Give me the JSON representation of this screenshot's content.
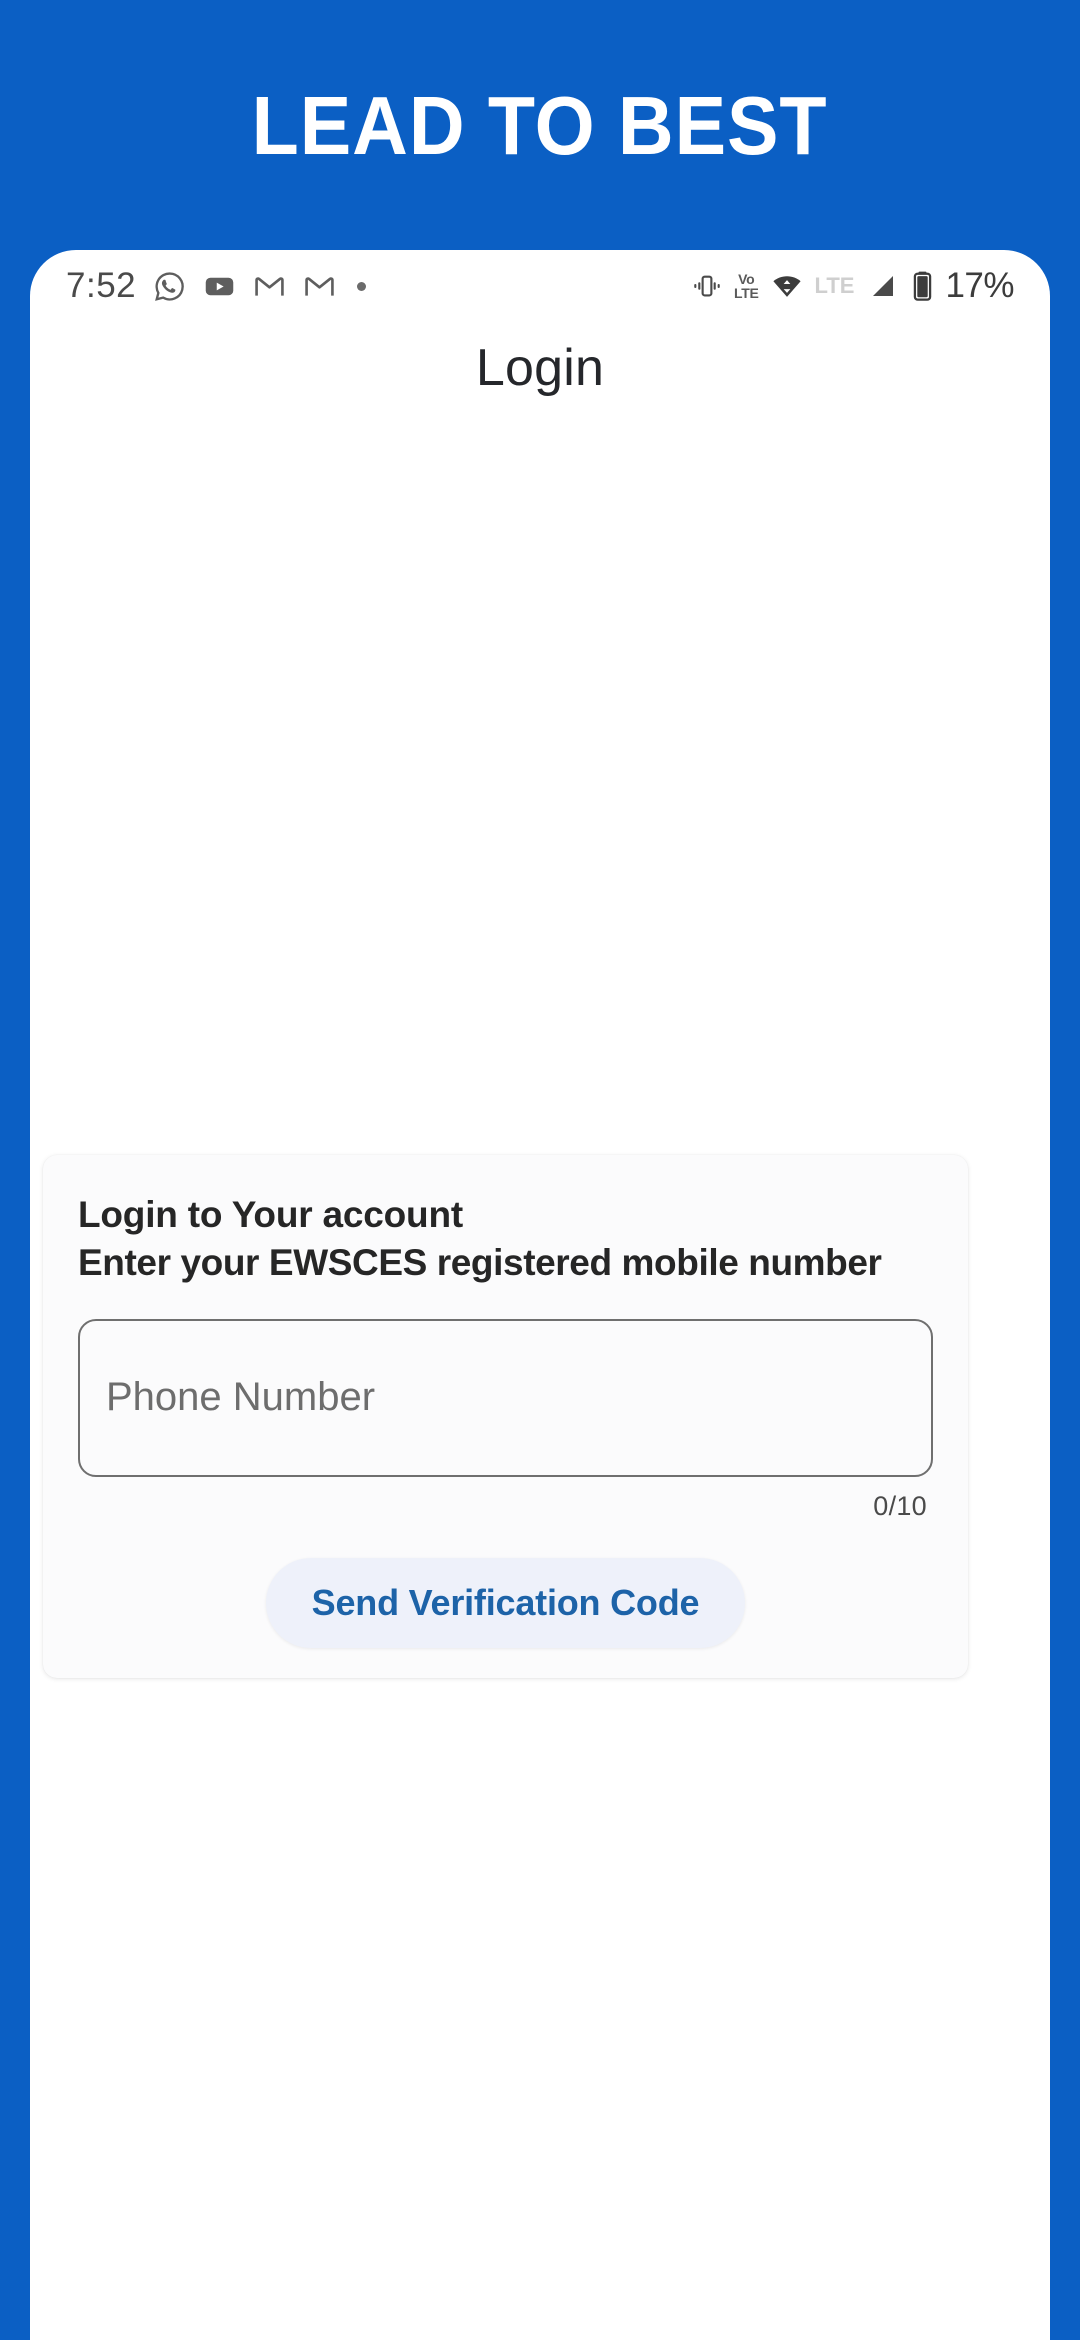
{
  "banner": {
    "title": "LEAD TO BEST",
    "background_color": "#0B5FC4",
    "text_color": "#FFFFFF"
  },
  "status_bar": {
    "time": "7:52",
    "left_icons": [
      {
        "name": "whatsapp-icon",
        "label": "WhatsApp"
      },
      {
        "name": "youtube-icon",
        "label": "YouTube"
      },
      {
        "name": "gmail-icon",
        "label": "Gmail"
      },
      {
        "name": "gmail-icon-2",
        "label": "Gmail"
      },
      {
        "name": "more-notifications-dot",
        "label": "More notifications"
      }
    ],
    "right_icons": [
      {
        "name": "vibrate-icon",
        "label": "Vibrate"
      },
      {
        "name": "volte-icon",
        "label": "VoLTE"
      },
      {
        "name": "wifi-icon",
        "label": "Wi-Fi"
      },
      {
        "name": "lte-label",
        "label": "LTE"
      },
      {
        "name": "signal-icon",
        "label": "Signal"
      },
      {
        "name": "battery-icon",
        "label": "Battery"
      }
    ],
    "volte_top": "Vo",
    "volte_bottom": "LTE",
    "lte_label": "LTE",
    "battery_percent": "17%"
  },
  "screen": {
    "title": "Login"
  },
  "card": {
    "heading_line1": "Login to Your account",
    "heading_line2": "Enter your EWSCES registered mobile number",
    "phone_input": {
      "value": "",
      "placeholder": "Phone Number"
    },
    "char_counter": "0/10",
    "send_button_label": "Send Verification Code",
    "send_button_bg": "#EEF1FA",
    "send_button_text_color": "#1D63A8"
  }
}
